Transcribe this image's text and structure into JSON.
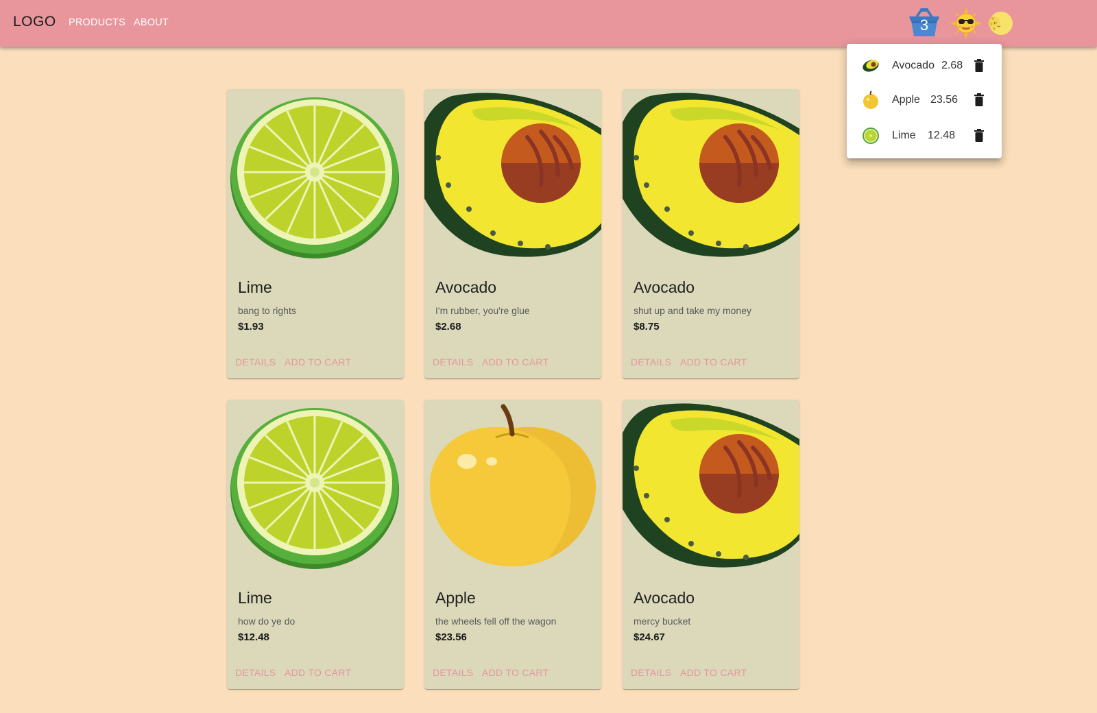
{
  "header": {
    "logo": "LOGO",
    "nav": [
      "PRODUCTS",
      "ABOUT"
    ],
    "cart_count": "3",
    "icons": [
      "basket-icon",
      "sun-sunglasses-icon",
      "moon-icon"
    ],
    "bar_color": "#e8959c"
  },
  "cart": {
    "items": [
      {
        "name": "Avocado",
        "price": "2.68",
        "icon": "avocado-icon"
      },
      {
        "name": "Apple",
        "price": "23.56",
        "icon": "apple-icon"
      },
      {
        "name": "Lime",
        "price": "12.48",
        "icon": "lime-icon"
      }
    ]
  },
  "products": [
    {
      "name": "Lime",
      "description": "bang to rights",
      "price": "$1.93",
      "image": "lime"
    },
    {
      "name": "Avocado",
      "description": "I'm rubber, you're glue",
      "price": "$2.68",
      "image": "avocado"
    },
    {
      "name": "Avocado",
      "description": "shut up and take my money",
      "price": "$8.75",
      "image": "avocado"
    },
    {
      "name": "Lime",
      "description": "how do ye do",
      "price": "$12.48",
      "image": "lime"
    },
    {
      "name": "Apple",
      "description": "the wheels fell off the wagon",
      "price": "$23.56",
      "image": "apple"
    },
    {
      "name": "Avocado",
      "description": "mercy bucket",
      "price": "$24.67",
      "image": "avocado"
    }
  ],
  "card_actions": {
    "details": "DETAILS",
    "add_to_cart": "ADD TO CART"
  },
  "colors": {
    "page_bg": "#fbdfbc",
    "card_bg": "#dbd9ba",
    "accent": "#e8959c"
  }
}
